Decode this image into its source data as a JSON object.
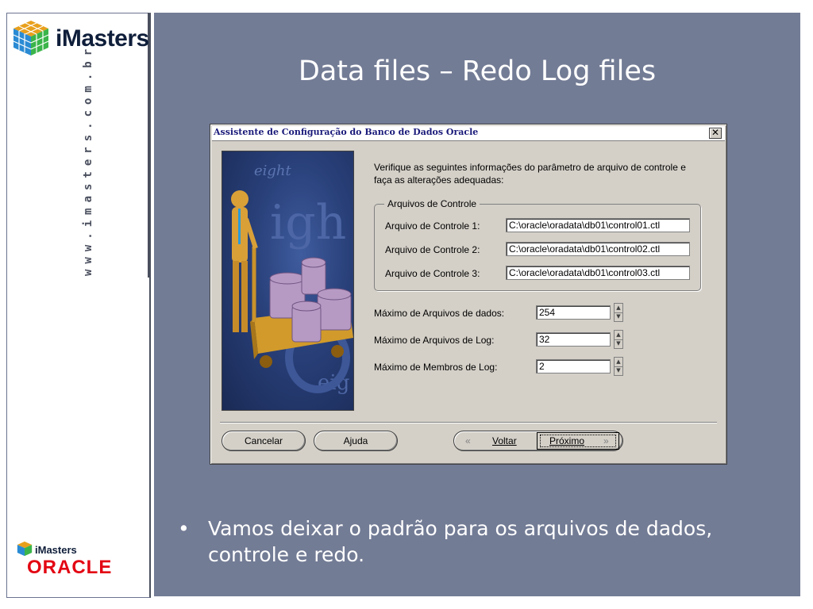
{
  "brand": {
    "name": "iMasters",
    "url_vertical": "www.imasters.com.br",
    "mini_name": "iMasters",
    "partner": "ORACLE"
  },
  "slide": {
    "title": "Data files – Redo Log files",
    "bullet": "Vamos deixar o padrão para os arquivos de dados, controle e redo."
  },
  "dialog": {
    "title": "Assistente de Configuração do Banco de Dados Oracle",
    "close_glyph": "✕",
    "instruction": "Verifique as seguintes informações do parâmetro de arquivo de controle e faça as alterações adequadas:",
    "control_group": {
      "legend": "Arquivos de Controle",
      "rows": [
        {
          "label": "Arquivo de Controle 1:",
          "value": "C:\\oracle\\oradata\\db01\\control01.ctl"
        },
        {
          "label": "Arquivo de Controle 2:",
          "value": "C:\\oracle\\oradata\\db01\\control02.ctl"
        },
        {
          "label": "Arquivo de Controle 3:",
          "value": "C:\\oracle\\oradata\\db01\\control03.ctl"
        }
      ]
    },
    "params": [
      {
        "label": "Máximo de Arquivos de dados:",
        "value": "254"
      },
      {
        "label": "Máximo de Arquivos de Log:",
        "value": "32"
      },
      {
        "label": "Máximo de Membros de Log:",
        "value": "2"
      }
    ],
    "buttons": {
      "cancel": "Cancelar",
      "help": "Ajuda",
      "back": "Voltar",
      "next": "Próximo",
      "back_glyph": "«",
      "next_glyph": "»"
    }
  },
  "colors": {
    "slide_bg": "#737c95",
    "dialog_bg": "#d4d0c8",
    "oracle_red": "#e30613",
    "brand_navy": "#0f1e3a"
  }
}
